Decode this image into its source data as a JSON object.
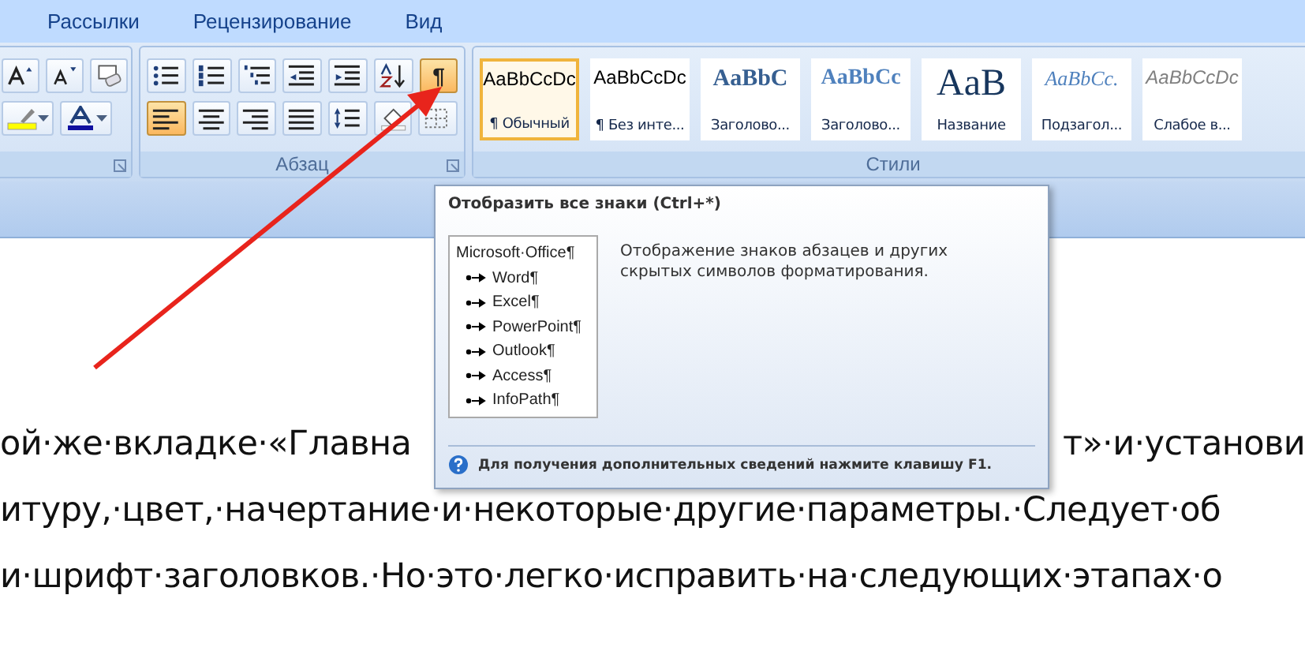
{
  "tabs": [
    {
      "label": "Рассылки",
      "selected": false
    },
    {
      "label": "Рецензирование",
      "selected": false
    },
    {
      "label": "Вид",
      "selected": false
    }
  ],
  "font_group": {
    "row1": [
      {
        "kind": "grow"
      },
      {
        "kind": "shrink"
      },
      {
        "kind": "clear"
      }
    ],
    "row2": [
      {
        "kind": "highlight"
      },
      {
        "kind": "font-color"
      }
    ]
  },
  "paragraph_group": {
    "label": "Абзац",
    "row1": [
      {
        "kind": "bullets",
        "selected": false
      },
      {
        "kind": "numbering",
        "selected": false
      },
      {
        "kind": "multilevel",
        "selected": false
      },
      {
        "kind": "outdent",
        "selected": false
      },
      {
        "kind": "indent",
        "selected": false
      },
      {
        "kind": "sort",
        "selected": false
      },
      {
        "kind": "pilcrow",
        "label": "¶",
        "selected": true
      }
    ],
    "row2": [
      {
        "kind": "align-left",
        "selected": true
      },
      {
        "kind": "align-center",
        "selected": false
      },
      {
        "kind": "align-right",
        "selected": false
      },
      {
        "kind": "justify",
        "selected": false
      },
      {
        "kind": "line-spacing",
        "selected": false
      },
      {
        "kind": "shading",
        "selected": false
      },
      {
        "kind": "borders",
        "selected": false
      }
    ]
  },
  "styles_group": {
    "label": "Стили",
    "items": [
      {
        "sample": "AaBbCcDc",
        "label": "¶ Обычный",
        "kind": "normal",
        "selected": true
      },
      {
        "sample": "AaBbCcDc",
        "label": "¶ Без инте...",
        "kind": "normal",
        "selected": false
      },
      {
        "sample": "AaBbC",
        "label": "Заголово...",
        "kind": "heading1",
        "selected": false
      },
      {
        "sample": "AaBbCc",
        "label": "Заголово...",
        "kind": "heading2",
        "selected": false
      },
      {
        "sample": "AaB",
        "label": "Название",
        "kind": "title",
        "selected": false
      },
      {
        "sample": "AaBbCc.",
        "label": "Подзагол...",
        "kind": "subtitle",
        "selected": false
      },
      {
        "sample": "AaBbCcDc",
        "label": "Слабое в...",
        "kind": "subtle",
        "selected": false
      }
    ]
  },
  "tooltip": {
    "title": "Отобразить все знаки (Ctrl+*)",
    "preview": {
      "heading": "Microsoft·Office¶",
      "items": [
        "Word¶",
        "Excel¶",
        "PowerPoint¶",
        "Outlook¶",
        "Access¶",
        "InfoPath¶"
      ]
    },
    "description": "Отображение знаков абзацев и других скрытых символов форматирования.",
    "footer": "Для получения дополнительных сведений нажмите клавишу F1."
  },
  "document": {
    "lines": [
      [
        "ой·же·вкладке·«Главна",
        "т»·и·установи"
      ],
      [
        "итуру,·цвет,·начертание·и·некоторые·другие·параметры.·Следует·об"
      ],
      [
        "и·шрифт·заголовков.·Но·это·легко·исправить·на·следующих·этапах·о"
      ]
    ]
  }
}
